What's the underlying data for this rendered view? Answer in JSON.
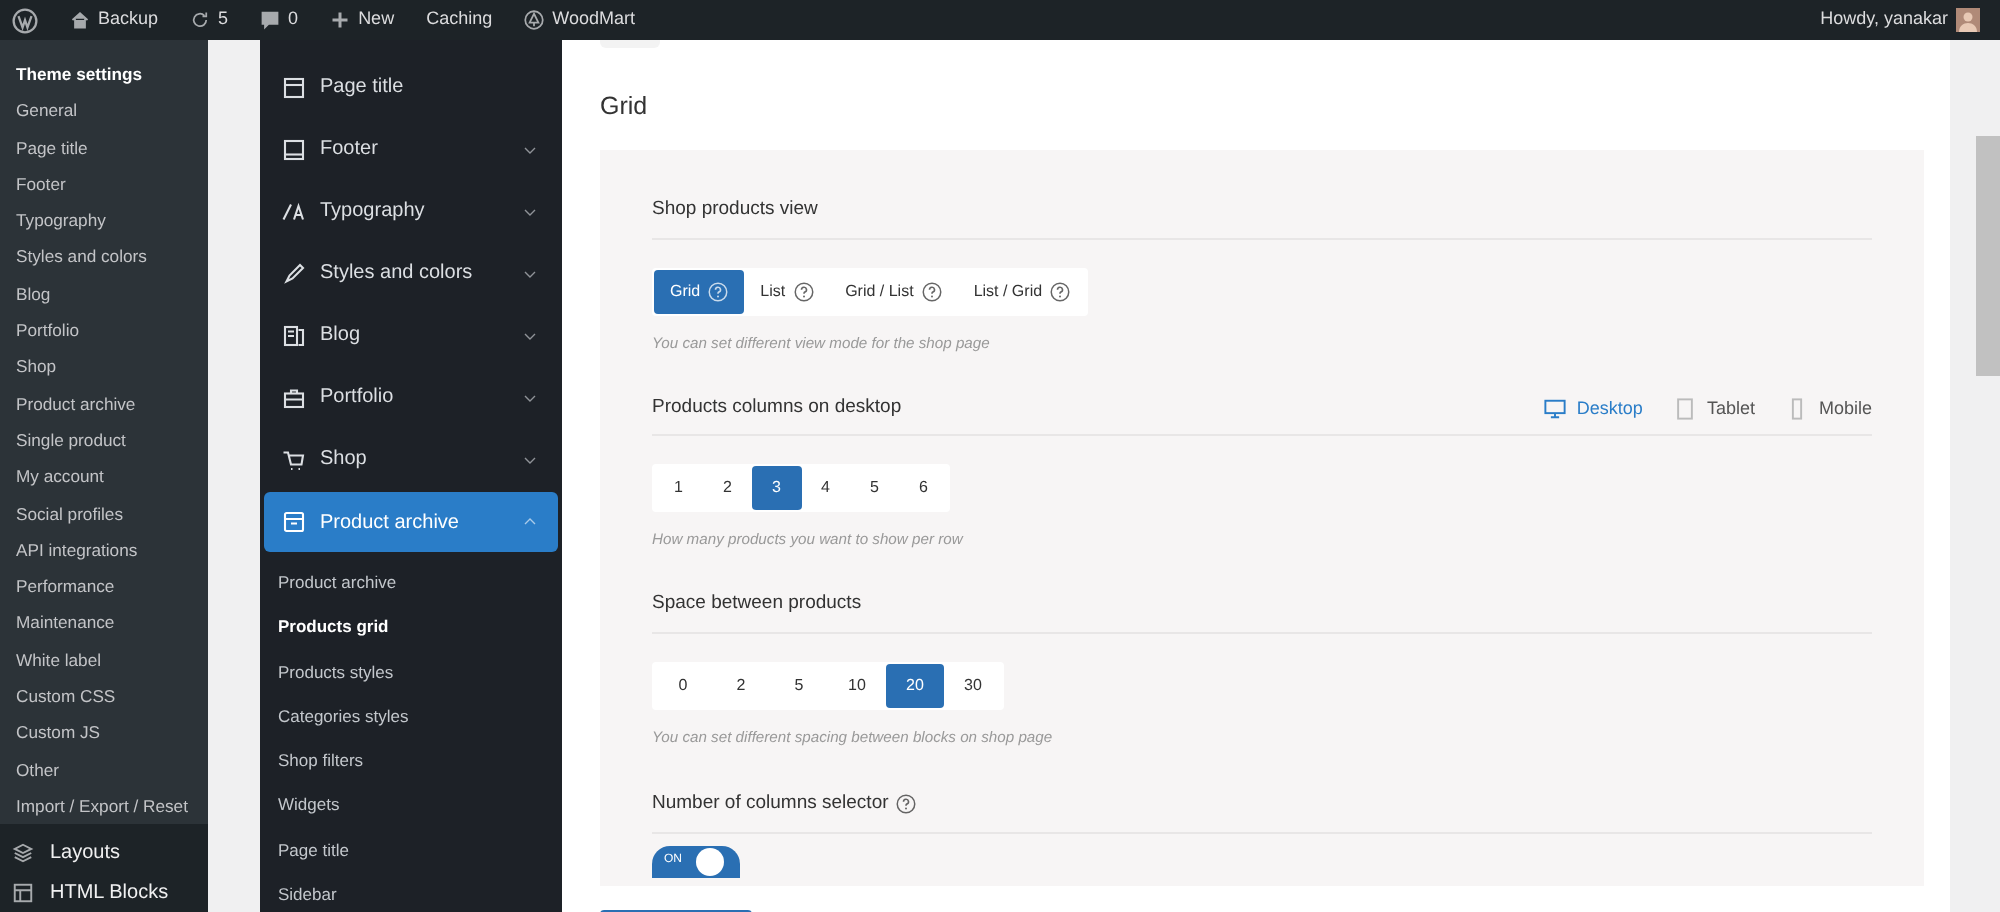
{
  "admin_bar": {
    "items": [
      {
        "kind": "wp"
      },
      {
        "kind": "home",
        "label": "Backup"
      },
      {
        "kind": "updates",
        "label": "5"
      },
      {
        "kind": "comments",
        "label": "0"
      },
      {
        "kind": "new",
        "label": "New"
      },
      {
        "kind": "text",
        "label": "Caching"
      },
      {
        "kind": "woodmart",
        "label": "WoodMart"
      }
    ],
    "greeting": "Howdy, yanakar"
  },
  "admin_menu": {
    "items": [
      {
        "label": "Theme settings",
        "selected": true
      },
      {
        "label": "General",
        "selected": false
      },
      {
        "label": "Page title",
        "selected": false
      },
      {
        "label": "Footer",
        "selected": false
      },
      {
        "label": "Typography",
        "selected": false
      },
      {
        "label": "Styles and colors",
        "selected": false
      },
      {
        "label": "Blog",
        "selected": false
      },
      {
        "label": "Portfolio",
        "selected": false
      },
      {
        "label": "Shop",
        "selected": false
      },
      {
        "label": "Product archive",
        "selected": false
      },
      {
        "label": "Single product",
        "selected": false
      },
      {
        "label": "My account",
        "selected": false
      },
      {
        "label": "Social profiles",
        "selected": false
      },
      {
        "label": "API integrations",
        "selected": false
      },
      {
        "label": "Performance",
        "selected": false
      },
      {
        "label": "Maintenance",
        "selected": false
      },
      {
        "label": "White label",
        "selected": false
      },
      {
        "label": "Custom CSS",
        "selected": false
      },
      {
        "label": "Custom JS",
        "selected": false
      },
      {
        "label": "Other",
        "selected": false
      },
      {
        "label": "Import / Export / Reset",
        "selected": false
      }
    ],
    "sections": [
      {
        "kind": "layers",
        "label": "Layouts"
      },
      {
        "kind": "blocks",
        "label": "HTML Blocks"
      }
    ]
  },
  "theme_nav": {
    "items": [
      {
        "kind": "window",
        "label": "Page title",
        "selected": false
      },
      {
        "kind": "footer",
        "label": "Footer",
        "selected": false,
        "expanded": false
      },
      {
        "kind": "type",
        "label": "Typography",
        "selected": false,
        "expanded": false
      },
      {
        "kind": "brush",
        "label": "Styles and colors",
        "selected": false,
        "expanded": false
      },
      {
        "kind": "blog",
        "label": "Blog",
        "selected": false,
        "expanded": false
      },
      {
        "kind": "briefcase",
        "label": "Portfolio",
        "selected": false,
        "expanded": false
      },
      {
        "kind": "cart",
        "label": "Shop",
        "selected": false,
        "expanded": false
      },
      {
        "kind": "archive",
        "label": "Product archive",
        "selected": true,
        "expanded": true,
        "children": [
          {
            "label": "Product archive",
            "selected": false
          },
          {
            "label": "Products grid",
            "selected": true
          },
          {
            "label": "Products styles",
            "selected": false
          },
          {
            "label": "Categories styles",
            "selected": false
          },
          {
            "label": "Shop filters",
            "selected": false
          },
          {
            "label": "Widgets",
            "selected": false
          },
          {
            "label": "Page title",
            "selected": false
          },
          {
            "label": "Sidebar",
            "selected": false
          }
        ]
      }
    ]
  },
  "content": {
    "heading": "Grid",
    "fields": [
      {
        "kind": "segmented",
        "label": "Shop products view",
        "options": [
          {
            "label": "Grid",
            "help": true,
            "selected": true
          },
          {
            "label": "List",
            "help": true,
            "selected": false
          },
          {
            "label": "Grid / List",
            "help": true,
            "selected": false
          },
          {
            "label": "List / Grid",
            "help": true,
            "selected": false
          }
        ],
        "description": "You can set different view mode for the shop page"
      },
      {
        "kind": "segmented",
        "label": "Products columns on desktop",
        "devices": [
          {
            "kind": "desktop",
            "label": "Desktop",
            "selected": true
          },
          {
            "kind": "tablet",
            "label": "Tablet",
            "selected": false
          },
          {
            "kind": "mobile",
            "label": "Mobile",
            "selected": false
          }
        ],
        "options": [
          {
            "label": "1",
            "selected": false
          },
          {
            "label": "2",
            "selected": false
          },
          {
            "label": "3",
            "selected": true
          },
          {
            "label": "4",
            "selected": false
          },
          {
            "label": "5",
            "selected": false
          },
          {
            "label": "6",
            "selected": false
          }
        ],
        "description": "How many products you want to show per row"
      },
      {
        "kind": "segmented",
        "label": "Space between products",
        "options": [
          {
            "label": "0",
            "selected": false
          },
          {
            "label": "2",
            "selected": false
          },
          {
            "label": "5",
            "selected": false
          },
          {
            "label": "10",
            "selected": false
          },
          {
            "label": "20",
            "selected": true
          },
          {
            "label": "30",
            "selected": false
          }
        ],
        "description": "You can set different spacing between blocks on shop page"
      },
      {
        "kind": "switch",
        "label": "Number of columns selector",
        "help": true,
        "on": true,
        "text": "ON"
      }
    ]
  }
}
